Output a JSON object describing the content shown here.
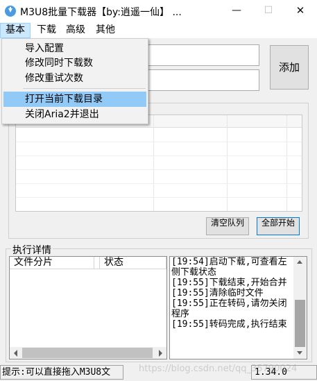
{
  "window": {
    "title": "M3U8批量下载器【by:逍遥一仙】 ...",
    "minimize_glyph": "—",
    "maximize_glyph": "☐",
    "close_glyph": "✕",
    "icon": "download-icon"
  },
  "menubar": {
    "items": [
      {
        "label": "基本"
      },
      {
        "label": "下载"
      },
      {
        "label": "高级"
      },
      {
        "label": "其他"
      }
    ]
  },
  "dropdown": {
    "items": [
      {
        "label": "导入配置"
      },
      {
        "label": "修改同时下载数"
      },
      {
        "label": "修改重试次数"
      },
      {
        "label": "打开当前下载目录"
      },
      {
        "label": "关闭Aria2并退出"
      }
    ]
  },
  "add_panel": {
    "add_button": "添加"
  },
  "task_panel": {
    "clear_button": "清空队列",
    "start_all_button": "全部开始"
  },
  "details": {
    "legend": "执行详情",
    "columns": [
      "文件分片",
      "状态"
    ],
    "log_lines": [
      "[19:54]启动下载,可查看左侧下载状态",
      "[19:55]下载结束,开始合并",
      "[19:55]清除临时文件",
      "[19:55]正在转码,请勿关闭程序",
      "[19:55]转码完成,执行结束"
    ]
  },
  "statusbar": {
    "hint": "提示:可以直接拖入M3U8文",
    "version": "1.34.0"
  },
  "watermark": "https://blog.csdn.net/qq_35790024"
}
